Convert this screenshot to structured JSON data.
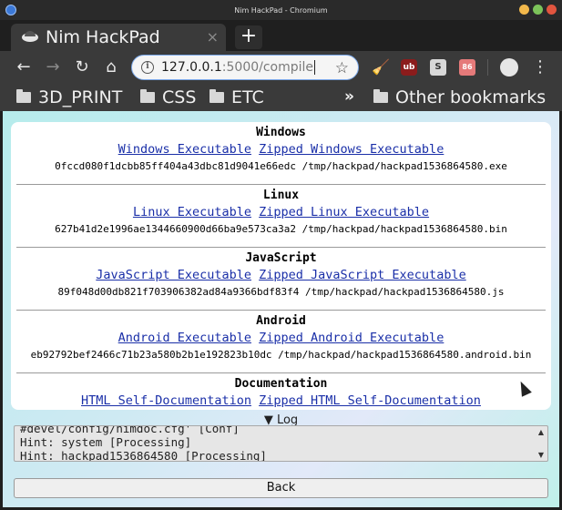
{
  "window": {
    "title": "Nim HackPad - Chromium"
  },
  "tab": {
    "title": "Nim HackPad",
    "close": "×",
    "new_tab": "+"
  },
  "toolbar": {
    "back": "←",
    "forward": "→",
    "reload": "↻",
    "home": "⌂",
    "url_host": "127.0.0.1",
    "url_path": ":5000/compile",
    "star": "☆",
    "ext_ublock": "ub",
    "ext_s": "S",
    "ext_pic": "86",
    "menu": "⋮"
  },
  "bookmarks": {
    "items": [
      "3D_PRINT",
      "CSS",
      "ETC"
    ],
    "more": "»",
    "other": "Other bookmarks"
  },
  "sections": [
    {
      "title": "Windows",
      "link1": "Windows Executable",
      "link2": "Zipped Windows Executable",
      "hash_line": "0fccd080f1dcbb85ff404a43dbc81d9041e66edc /tmp/hackpad/hackpad1536864580.exe"
    },
    {
      "title": "Linux",
      "link1": "Linux Executable",
      "link2": "Zipped Linux Executable",
      "hash_line": "627b41d2e1996ae1344660900d66ba9e573ca3a2 /tmp/hackpad/hackpad1536864580.bin"
    },
    {
      "title": "JavaScript",
      "link1": "JavaScript Executable",
      "link2": "Zipped JavaScript Executable",
      "hash_line": "89f048d00db821f703906382ad84a9366bdf83f4 /tmp/hackpad/hackpad1536864580.js"
    },
    {
      "title": "Android",
      "link1": "Android Executable",
      "link2": "Zipped Android Executable",
      "hash_line": "eb92792bef2466c71b23a580b2b1e192823b10dc /tmp/hackpad/hackpad1536864580.android.bin"
    },
    {
      "title": "Documentation",
      "link1": "HTML Self-Documentation",
      "link2": "Zipped HTML Self-Documentation",
      "hash_line": ""
    }
  ],
  "log": {
    "toggle_label": "▼ Log",
    "line1": "#devel/config/nimdoc.cfg' [Conf]",
    "line2": "Hint: system [Processing]",
    "line3": "Hint: hackpad1536864580 [Processing]"
  },
  "back_button": {
    "label": "Back"
  }
}
